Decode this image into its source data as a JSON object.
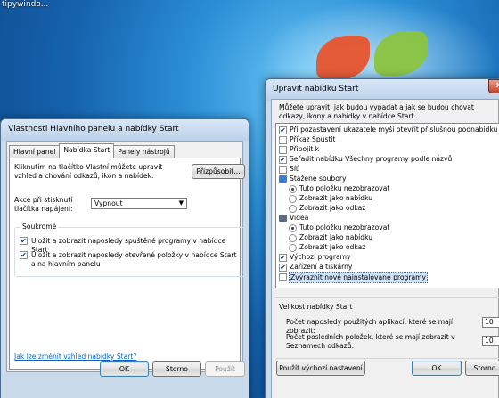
{
  "desktop": {
    "watermark": "tipywindo..."
  },
  "left_window": {
    "title": "Vlastnosti Hlavního panelu a nabídky Start",
    "tabs": [
      {
        "label": "Hlavní panel"
      },
      {
        "label": "Nabídka Start"
      },
      {
        "label": "Panely nástrojů"
      }
    ],
    "intro_text": "Kliknutím na tlačítko Vlastní můžete upravit vzhled a chování odkazů, ikon a nabídek.",
    "customize_button": "Přizpůsobit...",
    "power_action_label": "Akce při stisknutí tlačítka napájení:",
    "power_action_value": "Vypnout",
    "privacy_group_title": "Soukromé",
    "privacy_checks": [
      {
        "label": "Uložit a zobrazit naposledy spuštěné programy v nabídce Start",
        "checked": true
      },
      {
        "label": "Uložit a zobrazit naposledy otevřené položky v nabídce Start a na hlavním panelu",
        "checked": true
      }
    ],
    "help_link": "Jak lze změnit vzhled nabídky Start?",
    "buttons": {
      "ok": "OK",
      "cancel": "Storno",
      "apply": "Použít"
    }
  },
  "right_window": {
    "title": "Upravit nabídku Start",
    "intro_text": "Můžete upravit, jak budou vypadat a jak se budou chovat odkazy, ikony a nabídky v nabídce Start.",
    "list_items": [
      {
        "type": "check",
        "checked": true,
        "indent": 0,
        "label": "Při pozastavení ukazatele myši otevřít příslušnou podnabídku"
      },
      {
        "type": "check",
        "checked": false,
        "indent": 0,
        "label": "Příkaz Spustit"
      },
      {
        "type": "check",
        "checked": false,
        "indent": 0,
        "label": "Připojit k"
      },
      {
        "type": "check",
        "checked": true,
        "indent": 0,
        "label": "Seřadit nabídku Všechny programy podle názvů"
      },
      {
        "type": "check",
        "checked": false,
        "indent": 0,
        "label": "Síť"
      },
      {
        "type": "folder",
        "indent": 0,
        "label": "Stažené soubory"
      },
      {
        "type": "radio",
        "checked": true,
        "indent": 1,
        "label": "Tuto položku nezobrazovat"
      },
      {
        "type": "radio",
        "checked": false,
        "indent": 1,
        "label": "Zobrazit jako nabídku"
      },
      {
        "type": "radio",
        "checked": false,
        "indent": 1,
        "label": "Zobrazit jako odkaz"
      },
      {
        "type": "folder",
        "indent": 0,
        "label": "Videa"
      },
      {
        "type": "radio",
        "checked": true,
        "indent": 1,
        "label": "Tuto položku nezobrazovat"
      },
      {
        "type": "radio",
        "checked": false,
        "indent": 1,
        "label": "Zobrazit jako nabídku"
      },
      {
        "type": "radio",
        "checked": false,
        "indent": 1,
        "label": "Zobrazit jako odkaz"
      },
      {
        "type": "check",
        "checked": true,
        "indent": 0,
        "label": "Výchozí programy"
      },
      {
        "type": "check",
        "checked": true,
        "indent": 0,
        "label": "Zařízení a tiskárny"
      },
      {
        "type": "check",
        "checked": false,
        "indent": 0,
        "label": "Zvýraznit nově nainstalované programy",
        "selected": true
      }
    ],
    "size_section_title": "Velikost nabídky Start",
    "recent_programs_label": "Počet naposledy použitých aplikací, které se mají zobrazit:",
    "recent_programs_value": "10",
    "recent_items_label": "Počet posledních položek, které se mají zobrazit v Seznamech odkazů:",
    "recent_items_value": "10",
    "buttons": {
      "defaults": "Použít výchozí nastavení",
      "ok": "OK",
      "cancel": "Storno"
    }
  }
}
